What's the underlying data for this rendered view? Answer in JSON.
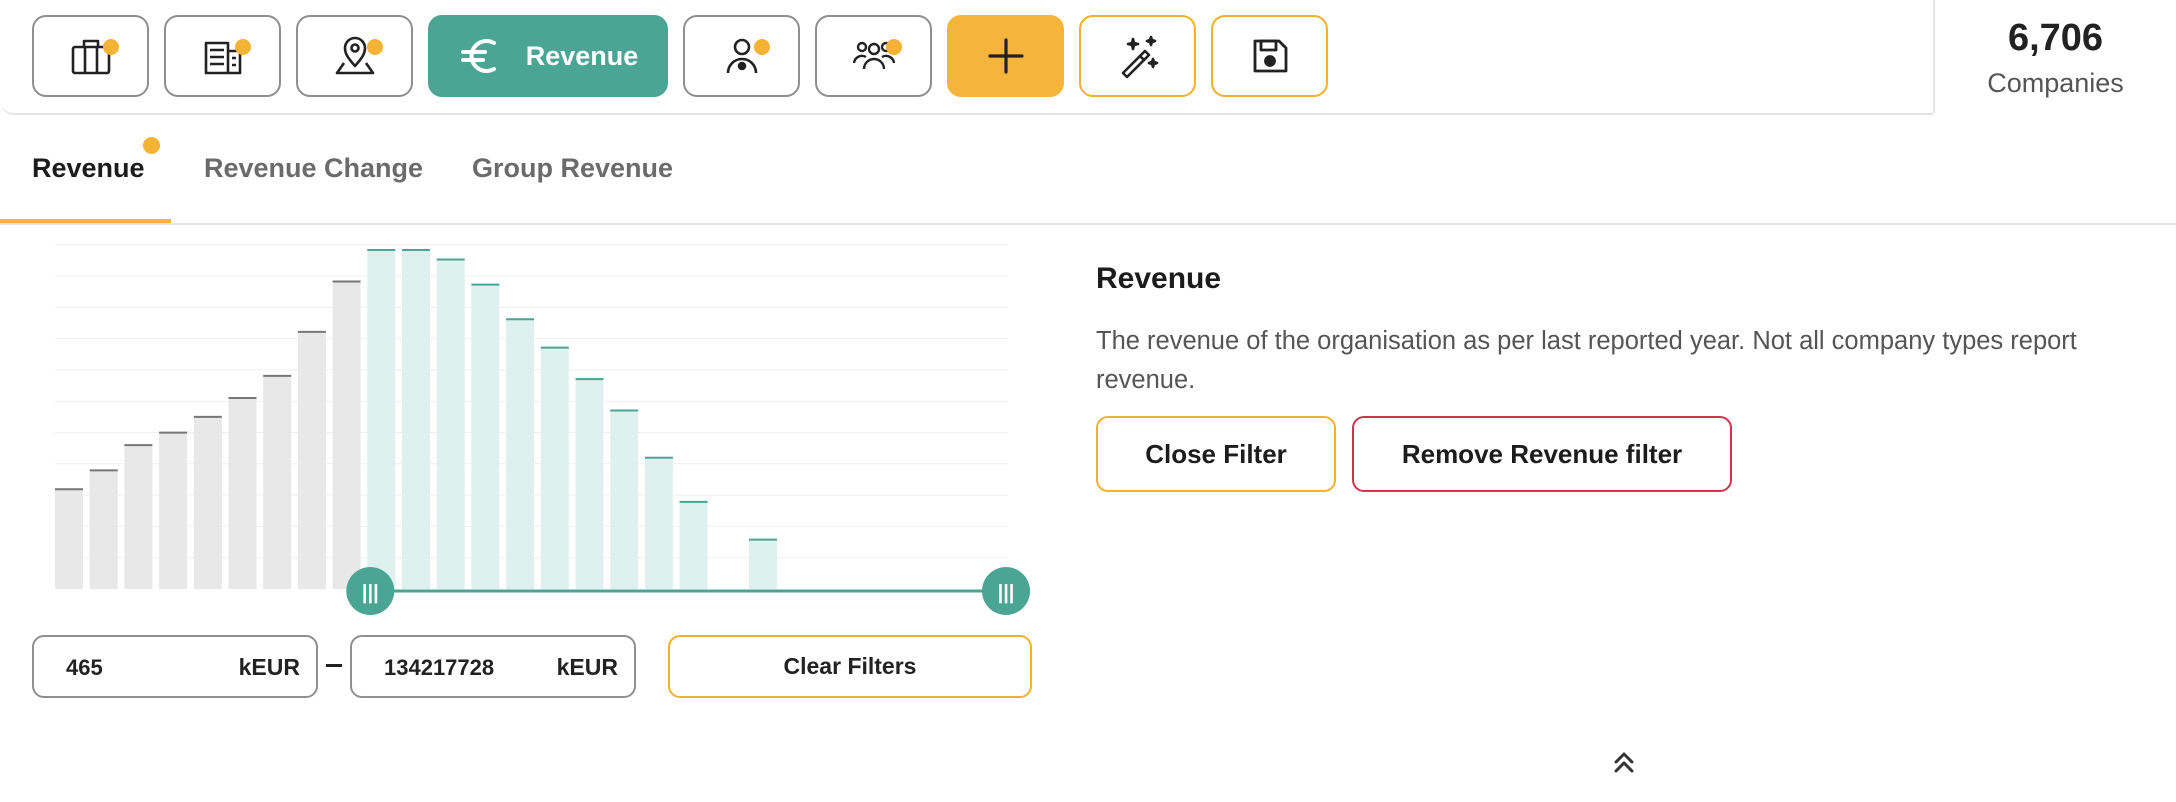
{
  "toolbar": {
    "buttons": [
      {
        "name": "industry-filter-button",
        "icon": "briefcase-icon",
        "has_dot": true
      },
      {
        "name": "company-register-button",
        "icon": "building-list-icon",
        "has_dot": true
      },
      {
        "name": "location-filter-button",
        "icon": "map-pin-icon",
        "has_dot": true
      },
      {
        "name": "revenue-filter-button",
        "icon": "euro-icon",
        "label": "Revenue",
        "active": true
      },
      {
        "name": "person-filter-button",
        "icon": "person-icon",
        "has_dot": true
      },
      {
        "name": "employees-filter-button",
        "icon": "group-icon",
        "has_dot": true
      },
      {
        "name": "add-filter-button",
        "icon": "plus-icon"
      },
      {
        "name": "magic-wand-button",
        "icon": "magic-wand-icon"
      },
      {
        "name": "save-button",
        "icon": "floppy-disk-icon"
      }
    ],
    "revenue_label": "Revenue"
  },
  "counter": {
    "value": "6,706",
    "label": "Companies"
  },
  "tabs": [
    {
      "label": "Revenue",
      "active": true,
      "has_dot": true
    },
    {
      "label": "Revenue Change",
      "active": false
    },
    {
      "label": "Group Revenue",
      "active": false
    }
  ],
  "chart_data": {
    "type": "bar",
    "title": "",
    "xlabel": "",
    "ylabel": "",
    "values": [
      32,
      38,
      46,
      50,
      55,
      61,
      68,
      82,
      98,
      108,
      108,
      105,
      97,
      86,
      77,
      67,
      57,
      42,
      28,
      0,
      16
    ],
    "selected_from_index": 9,
    "selected_to_index": 20,
    "colors": {
      "unselected": "#e8e8e8",
      "unselected_top": "#777777",
      "selected": "#dff1ee",
      "selected_top": "#4aa594"
    },
    "grid": true,
    "handle_left_label": "|||",
    "handle_right_label": "|||"
  },
  "range": {
    "min_value": "465",
    "max_value": "134217728",
    "unit": "kEUR",
    "separator": "–",
    "clear_label": "Clear Filters"
  },
  "info": {
    "title": "Revenue",
    "description": "The revenue of the organisation as per last reported year. Not all company types report revenue.",
    "close_label": "Close Filter",
    "remove_label": "Remove Revenue filter"
  },
  "colors": {
    "accent": "#4aa594",
    "warning": "#f5b335",
    "danger": "#d3324d"
  }
}
